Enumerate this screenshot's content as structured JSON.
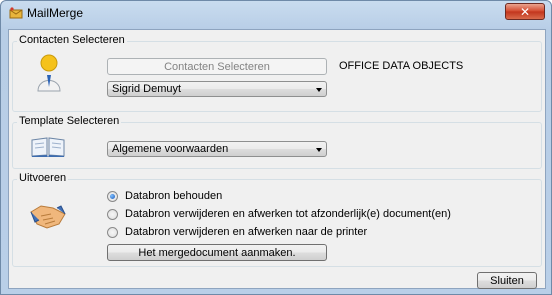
{
  "window": {
    "title": "MailMerge",
    "close_glyph": "✕",
    "icon": "app-icon"
  },
  "contacts": {
    "legend": "Contacten Selecteren",
    "button_label": "Contacten Selecteren",
    "source_label": "OFFICE DATA OBJECTS",
    "selected_contact": "Sigrid Demuyt",
    "icon": "person-icon"
  },
  "template": {
    "legend": "Template Selecteren",
    "selected_template": "Algemene voorwaarden",
    "icon": "open-book-icon"
  },
  "execute": {
    "legend": "Uitvoeren",
    "icon": "handshake-icon",
    "options": [
      {
        "label": "Databron behouden",
        "checked": true
      },
      {
        "label": "Databron verwijderen en afwerken tot afzonderlijk(e) document(en)",
        "checked": false
      },
      {
        "label": "Databron verwijderen en afwerken naar de printer",
        "checked": false
      }
    ],
    "create_button": "Het mergedocument aanmaken."
  },
  "footer": {
    "close_button": "Sluiten"
  }
}
